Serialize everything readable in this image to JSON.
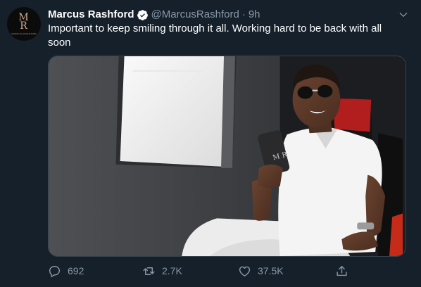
{
  "tweet": {
    "avatar_letters": [
      "M",
      "R"
    ],
    "avatar_subtext": "MARCUS RASHFORD",
    "author_name": "Marcus Rashford",
    "author_handle": "@MarcusRashford",
    "separator": "·",
    "time": "9h",
    "text": "Important to keep smiling through it all. Working hard to be back with all soon",
    "phone_case_letters": "M R",
    "reply_count": "692",
    "retweet_count": "2.7K",
    "like_count": "37.5K"
  },
  "icons": {
    "verified": "verified-badge-icon",
    "more": "chevron-down-icon",
    "reply": "reply-icon",
    "retweet": "retweet-icon",
    "like": "heart-icon",
    "share": "share-icon"
  },
  "colors": {
    "background": "#15202b",
    "secondary_text": "#8899a6",
    "accent": "#1da1f2",
    "border": "#38444d"
  }
}
